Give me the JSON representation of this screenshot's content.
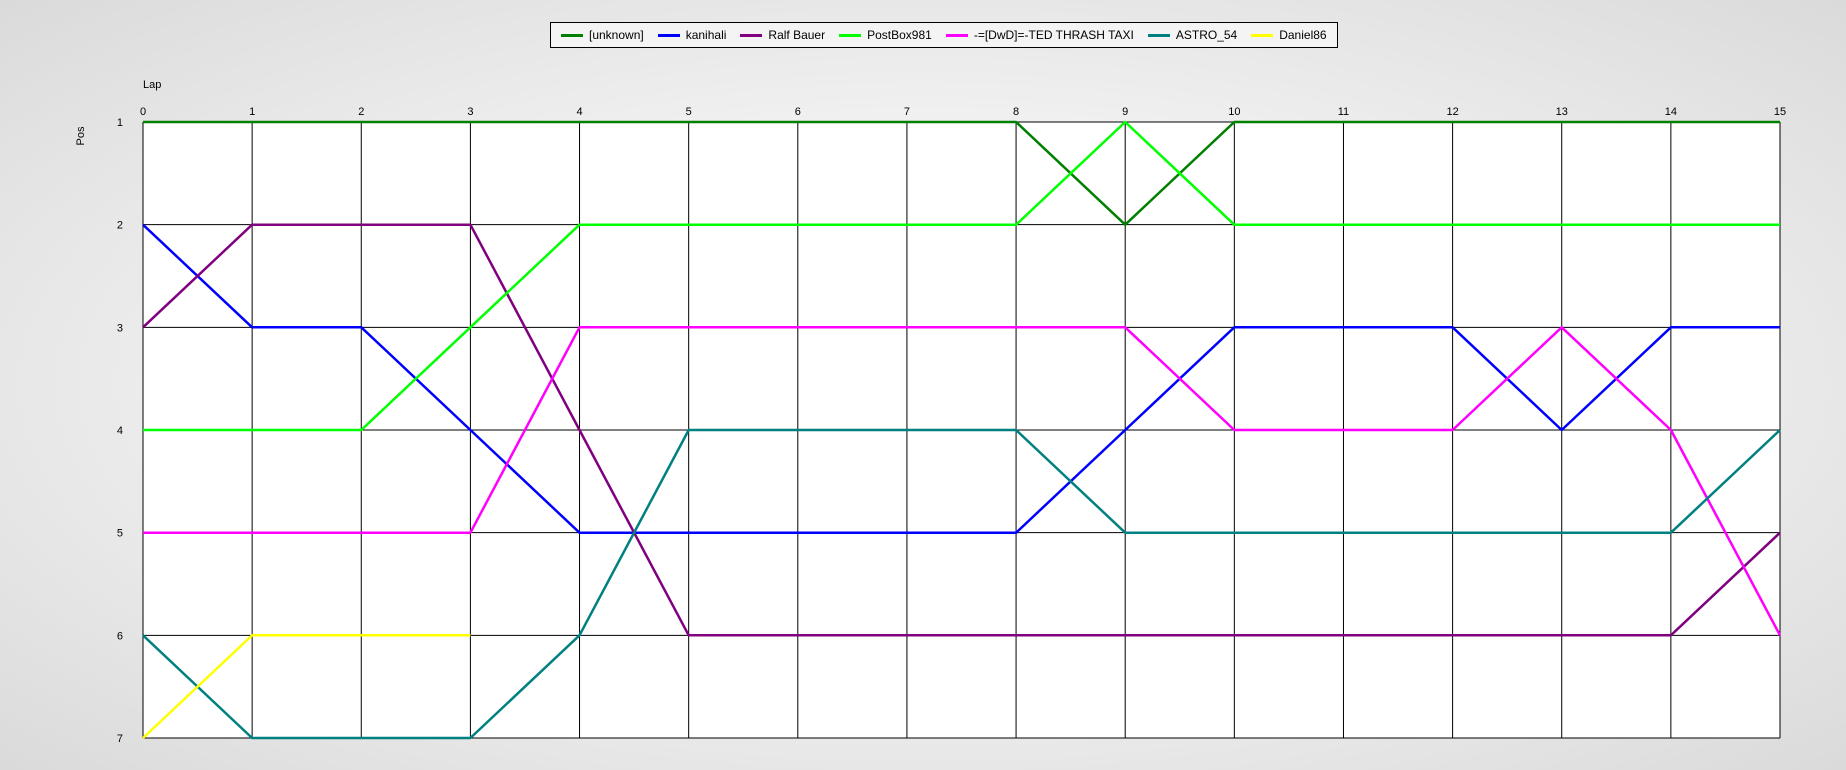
{
  "chart_data": {
    "type": "line",
    "xlabel": "Lap",
    "ylabel": "Pos",
    "x": [
      0,
      1,
      2,
      3,
      4,
      5,
      6,
      7,
      8,
      9,
      10,
      11,
      12,
      13,
      14,
      15
    ],
    "xlim": [
      0,
      15
    ],
    "ylim": [
      1,
      7
    ],
    "y_inverted": true,
    "y_ticks": [
      1,
      2,
      3,
      4,
      5,
      6,
      7
    ],
    "grid": true,
    "legend_position": "top",
    "series": [
      {
        "name": "[unknown]",
        "color": "#008000",
        "points": [
          [
            0,
            1
          ],
          [
            1,
            1
          ],
          [
            2,
            1
          ],
          [
            3,
            1
          ],
          [
            4,
            1
          ],
          [
            5,
            1
          ],
          [
            6,
            1
          ],
          [
            7,
            1
          ],
          [
            8,
            1
          ],
          [
            9,
            2
          ],
          [
            10,
            1
          ],
          [
            11,
            1
          ],
          [
            12,
            1
          ],
          [
            13,
            1
          ],
          [
            14,
            1
          ],
          [
            15,
            1
          ]
        ]
      },
      {
        "name": "kanihali",
        "color": "#0000ff",
        "points": [
          [
            0,
            2
          ],
          [
            1,
            3
          ],
          [
            2,
            3
          ],
          [
            3,
            4
          ],
          [
            4,
            5
          ],
          [
            5,
            5
          ],
          [
            6,
            5
          ],
          [
            7,
            5
          ],
          [
            8,
            5
          ],
          [
            9,
            4
          ],
          [
            10,
            3
          ],
          [
            11,
            3
          ],
          [
            12,
            3
          ],
          [
            13,
            4
          ],
          [
            14,
            3
          ],
          [
            15,
            3
          ]
        ]
      },
      {
        "name": "Ralf Bauer",
        "color": "#800080",
        "points": [
          [
            0,
            3
          ],
          [
            1,
            2
          ],
          [
            2,
            2
          ],
          [
            3,
            2
          ],
          [
            4,
            4
          ],
          [
            5,
            6
          ],
          [
            6,
            6
          ],
          [
            7,
            6
          ],
          [
            8,
            6
          ],
          [
            9,
            6
          ],
          [
            10,
            6
          ],
          [
            11,
            6
          ],
          [
            12,
            6
          ],
          [
            13,
            6
          ],
          [
            14,
            6
          ],
          [
            15,
            5
          ]
        ]
      },
      {
        "name": "PostBox981",
        "color": "#00ff00",
        "points": [
          [
            0,
            4
          ],
          [
            1,
            4
          ],
          [
            2,
            4
          ],
          [
            3,
            3
          ],
          [
            4,
            2
          ],
          [
            5,
            2
          ],
          [
            6,
            2
          ],
          [
            7,
            2
          ],
          [
            8,
            2
          ],
          [
            9,
            1
          ],
          [
            10,
            2
          ],
          [
            11,
            2
          ],
          [
            12,
            2
          ],
          [
            13,
            2
          ],
          [
            14,
            2
          ],
          [
            15,
            2
          ]
        ]
      },
      {
        "name": "-=[DwD]=-TED THRASH TAXI",
        "color": "#ff00ff",
        "points": [
          [
            0,
            5
          ],
          [
            1,
            5
          ],
          [
            2,
            5
          ],
          [
            3,
            5
          ],
          [
            4,
            3
          ],
          [
            5,
            3
          ],
          [
            6,
            3
          ],
          [
            7,
            3
          ],
          [
            8,
            3
          ],
          [
            9,
            3
          ],
          [
            10,
            4
          ],
          [
            11,
            4
          ],
          [
            12,
            4
          ],
          [
            13,
            3
          ],
          [
            14,
            4
          ],
          [
            15,
            6
          ]
        ]
      },
      {
        "name": "ASTRO_54",
        "color": "#008080",
        "points": [
          [
            0,
            6
          ],
          [
            1,
            7
          ],
          [
            2,
            7
          ],
          [
            3,
            7
          ],
          [
            4,
            6
          ],
          [
            5,
            4
          ],
          [
            6,
            4
          ],
          [
            7,
            4
          ],
          [
            8,
            4
          ],
          [
            9,
            5
          ],
          [
            10,
            5
          ],
          [
            11,
            5
          ],
          [
            12,
            5
          ],
          [
            13,
            5
          ],
          [
            14,
            5
          ],
          [
            15,
            4
          ]
        ]
      },
      {
        "name": "Daniel86",
        "color": "#ffff00",
        "points": [
          [
            0,
            7
          ],
          [
            1,
            6
          ],
          [
            2,
            6
          ],
          [
            3,
            6
          ]
        ]
      }
    ]
  }
}
